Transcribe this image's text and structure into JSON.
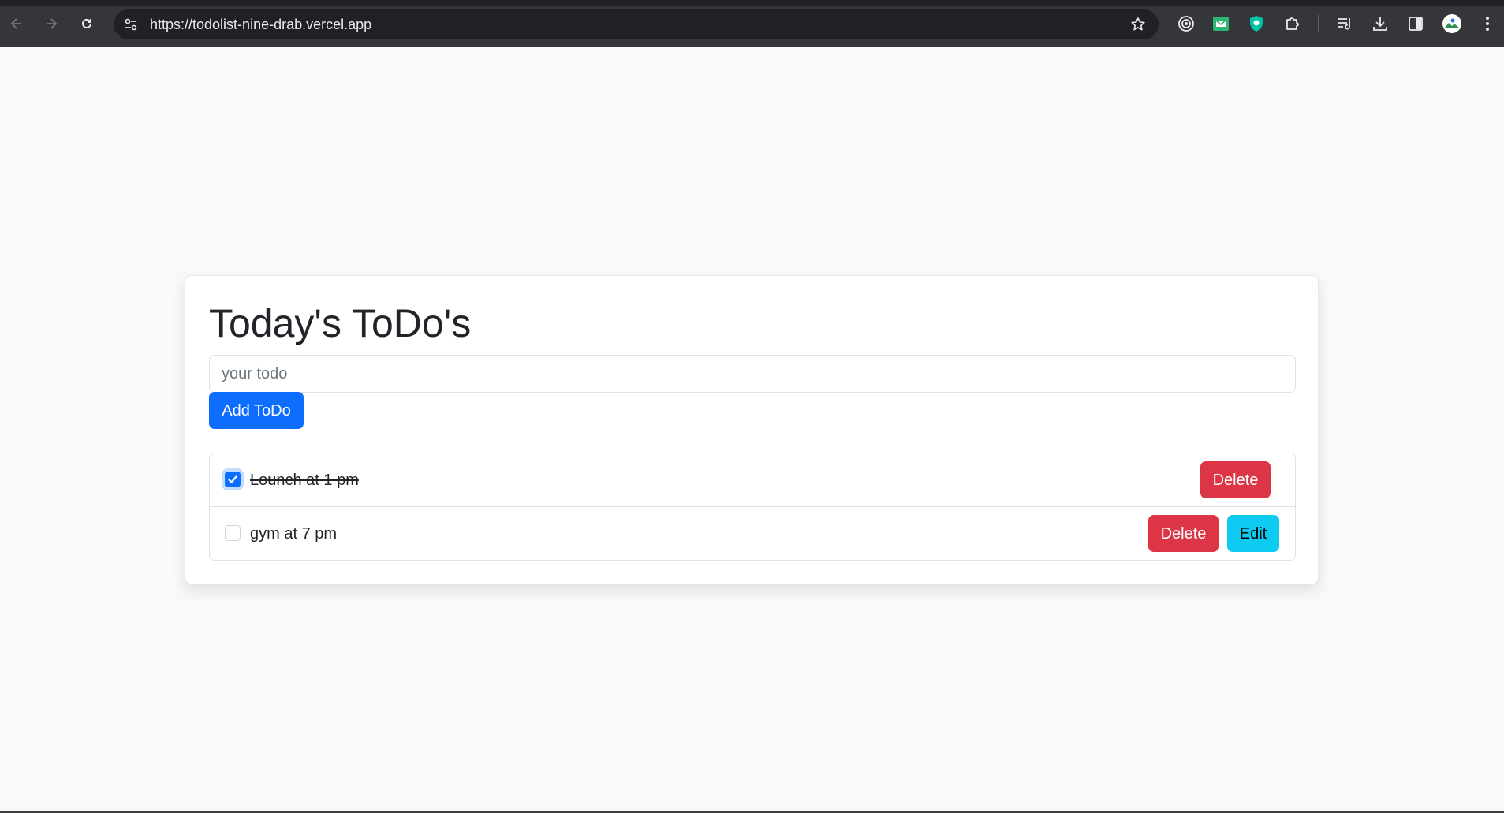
{
  "browser": {
    "url": "https://todolist-nine-drab.vercel.app",
    "icons": [
      "back-arrow-icon",
      "forward-arrow-icon",
      "reload-icon",
      "site-info-icon",
      "star-icon",
      "target-extension-icon",
      "mail-extension-icon",
      "shield-extension-icon",
      "puzzle-extensions-icon",
      "reading-list-icon",
      "download-icon",
      "side-panel-icon",
      "profile-avatar",
      "menu-kebab-icon"
    ]
  },
  "app": {
    "title": "Today's ToDo's",
    "input": {
      "placeholder": "your todo",
      "value": ""
    },
    "add_button_label": "Add ToDo",
    "todos": [
      {
        "text": "Lounch at 1 pm",
        "completed": true,
        "delete_label": "Delete"
      },
      {
        "text": "gym at 7 pm",
        "completed": false,
        "delete_label": "Delete",
        "edit_label": "Edit"
      }
    ]
  },
  "colors": {
    "primary": "#0d6efd",
    "danger": "#dc3545",
    "info": "#0dcaf0",
    "page_background": "#f8f9fa"
  }
}
